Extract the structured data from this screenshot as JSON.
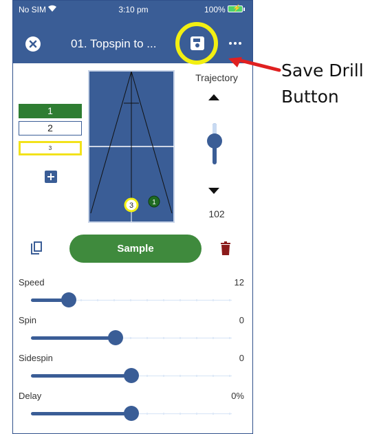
{
  "status_bar": {
    "carrier": "No SIM",
    "time": "3:10 pm",
    "battery": "100%"
  },
  "header": {
    "title": "01. Topspin to ...",
    "close_icon": "close-icon",
    "save_icon": "save-icon",
    "more_icon": "more-icon"
  },
  "balls": [
    {
      "label": "1",
      "state": "selected"
    },
    {
      "label": "2",
      "state": "normal"
    },
    {
      "label": "3",
      "state": "highlighted"
    }
  ],
  "table": {
    "markers": [
      {
        "label": "3",
        "style": "yellow-ring"
      },
      {
        "label": "1",
        "style": "green"
      }
    ]
  },
  "trajectory": {
    "label": "Trajectory",
    "value": "102",
    "level": 0.67
  },
  "actions": {
    "sample_label": "Sample"
  },
  "sliders": [
    {
      "label": "Speed",
      "value": "12",
      "fraction": 0.19
    },
    {
      "label": "Spin",
      "value": "0",
      "fraction": 0.42
    },
    {
      "label": "Sidespin",
      "value": "0",
      "fraction": 0.5
    },
    {
      "label": "Delay",
      "value": "0%",
      "fraction": 0.5
    }
  ],
  "annotation": {
    "line1": "Save Drill",
    "line2": "Button"
  },
  "colors": {
    "header": "#3a5d96",
    "accent_green": "#3f8a3d",
    "highlight_yellow": "#f2ef12",
    "delete_red": "#8b1a1a",
    "arrow_red": "#e02020"
  }
}
